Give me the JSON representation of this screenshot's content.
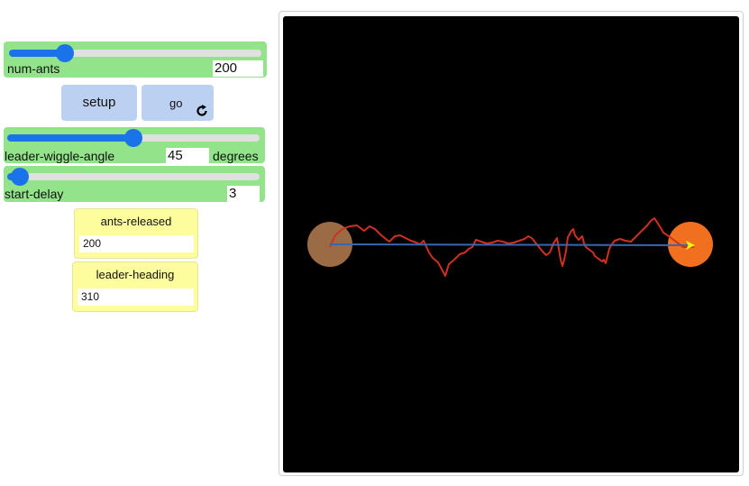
{
  "sliders": {
    "num_ants": {
      "label": "num-ants",
      "value": "200",
      "fraction": 0.22
    },
    "leader_wiggle_angle": {
      "label": "leader-wiggle-angle",
      "value": "45",
      "unit": "degrees",
      "fraction": 0.5
    },
    "start_delay": {
      "label": "start-delay",
      "value": "3",
      "fraction": 0.05
    }
  },
  "buttons": {
    "setup": "setup",
    "go": "go"
  },
  "monitors": {
    "ants_released": {
      "label": "ants-released",
      "value": "200"
    },
    "leader_heading": {
      "label": "leader-heading",
      "value": "310"
    }
  },
  "icons": {
    "go_forever": "forever-loop-icon"
  },
  "colors": {
    "slider_bg": "#92e38a",
    "button_bg": "#bcd0f2",
    "monitor_bg": "#fdfd9d",
    "accent": "#1a73e8",
    "nest": "#9b6b45",
    "food": "#f07020",
    "leader_trail": "#d03020",
    "straight_path": "#3a66b0"
  }
}
